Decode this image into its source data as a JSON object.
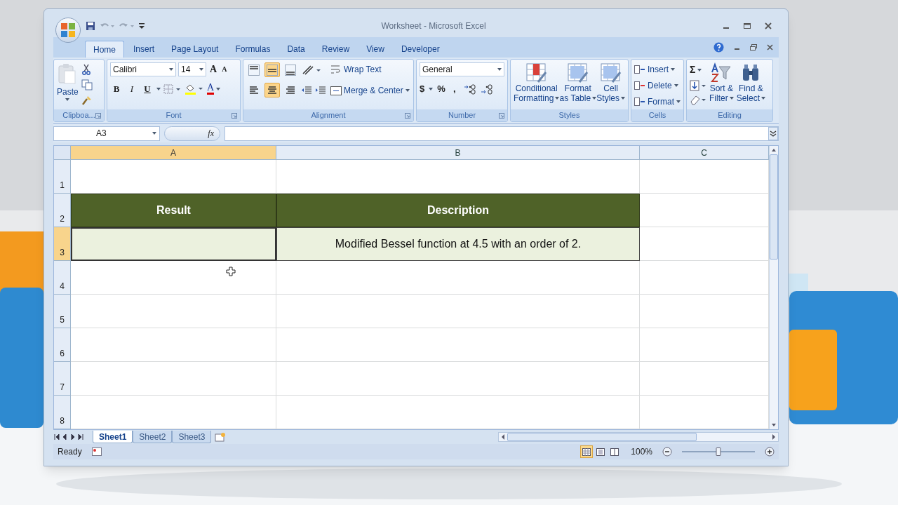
{
  "window": {
    "title": "Worksheet - Microsoft Excel"
  },
  "tabs": [
    {
      "label": "Home",
      "selected": true
    },
    {
      "label": "Insert",
      "selected": false
    },
    {
      "label": "Page Layout",
      "selected": false
    },
    {
      "label": "Formulas",
      "selected": false
    },
    {
      "label": "Data",
      "selected": false
    },
    {
      "label": "Review",
      "selected": false
    },
    {
      "label": "View",
      "selected": false
    },
    {
      "label": "Developer",
      "selected": false
    }
  ],
  "clipboard": {
    "label": "Clipboa...",
    "paste": "Paste"
  },
  "font": {
    "label": "Font",
    "name": "Calibri",
    "size": "14",
    "grow": "A",
    "shrink": "A",
    "bold": "B",
    "italic": "I",
    "underline": "U",
    "font_color_letter": "A"
  },
  "alignment": {
    "label": "Alignment",
    "vertical": [
      {
        "selected": false
      },
      {
        "selected": true
      },
      {
        "selected": false
      }
    ],
    "horizontal": [
      {
        "selected": false
      },
      {
        "selected": true
      },
      {
        "selected": false
      }
    ],
    "wrap_text": "Wrap Text",
    "merge": "Merge & Center"
  },
  "number": {
    "label": "Number",
    "format": "General",
    "currency": "$",
    "percent": "%",
    "comma": ","
  },
  "styles": {
    "label": "Styles",
    "buttons": [
      [
        "Conditional",
        "Formatting"
      ],
      [
        "Format",
        "as Table"
      ],
      [
        "Cell",
        "Styles"
      ]
    ]
  },
  "cells": {
    "label": "Cells",
    "buttons": [
      "Insert",
      "Delete",
      "Format"
    ]
  },
  "editing": {
    "label": "Editing",
    "sum": "Σ",
    "buttons": [
      [
        "Sort &",
        "Filter"
      ],
      [
        "Find &",
        "Select"
      ]
    ]
  },
  "formula_bar": {
    "name_box": "A3",
    "fx": "fx"
  },
  "columns": [
    {
      "label": "A",
      "selected": true
    },
    {
      "label": "B",
      "selected": false
    },
    {
      "label": "C",
      "selected": false
    }
  ],
  "rows": [
    {
      "label": "1",
      "selected": false,
      "kind": "plain"
    },
    {
      "label": "2",
      "selected": false,
      "kind": "header",
      "cells": [
        {
          "text": "Result",
          "active": false
        },
        {
          "text": "Description",
          "active": false
        }
      ]
    },
    {
      "label": "3",
      "selected": true,
      "kind": "data",
      "cells": [
        {
          "active": true
        },
        {
          "text": "Modified Bessel function at 4.5 with an order of 2.",
          "active": false
        }
      ]
    },
    {
      "label": "4",
      "selected": false,
      "kind": "plain"
    },
    {
      "label": "5",
      "selected": false,
      "kind": "plain"
    },
    {
      "label": "6",
      "selected": false,
      "kind": "plain"
    },
    {
      "label": "7",
      "selected": false,
      "kind": "plain"
    },
    {
      "label": "8",
      "selected": false,
      "kind": "plain"
    }
  ],
  "sheets": [
    {
      "label": "Sheet1",
      "selected": true
    },
    {
      "label": "Sheet2",
      "selected": false
    },
    {
      "label": "Sheet3",
      "selected": false
    }
  ],
  "status": {
    "text": "Ready",
    "zoom": "100%",
    "views": [
      {
        "selected": true
      },
      {
        "selected": false
      },
      {
        "selected": false
      }
    ],
    "zoom_slider": {
      "level": 0.5
    }
  }
}
